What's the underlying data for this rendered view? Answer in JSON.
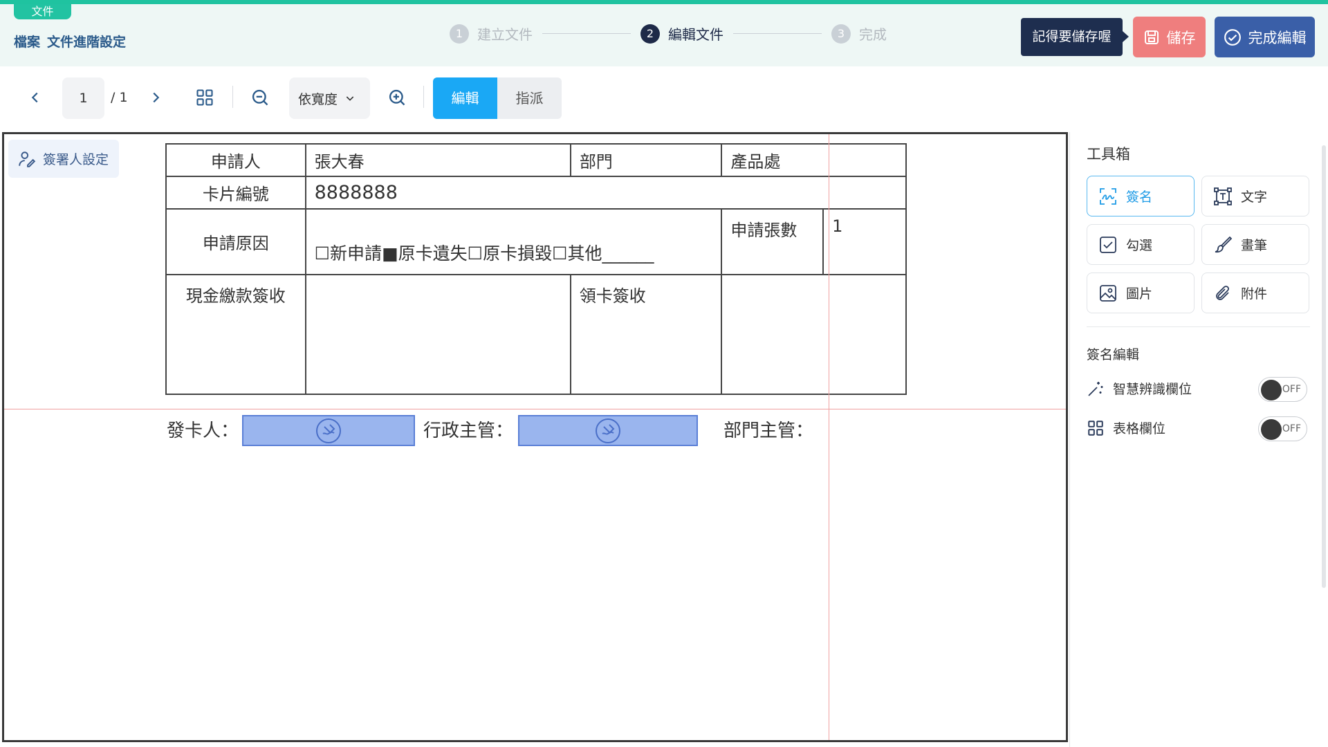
{
  "header": {
    "doc_tag": "文件",
    "breadcrumb_root": "檔案",
    "breadcrumb_page": "文件進階設定",
    "steps": [
      {
        "num": "1",
        "label": "建立文件"
      },
      {
        "num": "2",
        "label": "編輯文件"
      },
      {
        "num": "3",
        "label": "完成"
      }
    ],
    "reminder": "記得要儲存喔",
    "save_label": "儲存",
    "finish_label": "完成編輯"
  },
  "toolbar": {
    "current_page": "1",
    "total_pages": "/ 1",
    "zoom_mode": "依寬度",
    "mode_edit": "編輯",
    "mode_assign": "指派"
  },
  "canvas": {
    "signer_settings": "簽署人設定",
    "form": {
      "applicant_label": "申請人",
      "applicant_value": "張大春",
      "dept_label": "部門",
      "dept_value": "產品處",
      "card_no_label": "卡片編號",
      "card_no_value": "8888888",
      "reason_label": "申請原因",
      "reason_value": "☐新申請■原卡遺失☐原卡損毀☐其他______",
      "count_label": "申請張數",
      "count_value": "1",
      "cash_label": "現金繳款簽收",
      "receive_label": "領卡簽收"
    },
    "signatures": {
      "issuer_label": "發卡人：",
      "admin_label": "行政主管：",
      "dept_manager_label": "部門主管："
    }
  },
  "right_panel": {
    "toolbox_title": "工具箱",
    "tools": [
      {
        "label": "簽名",
        "icon": "signature-icon"
      },
      {
        "label": "文字",
        "icon": "text-icon"
      },
      {
        "label": "勾選",
        "icon": "checkbox-icon"
      },
      {
        "label": "畫筆",
        "icon": "brush-icon"
      },
      {
        "label": "圖片",
        "icon": "image-icon"
      },
      {
        "label": "附件",
        "icon": "paperclip-icon"
      }
    ],
    "sign_edit_title": "簽名編輯",
    "smart_detect_label": "智慧辨識欄位",
    "table_field_label": "表格欄位",
    "toggle_off": "OFF"
  },
  "colors": {
    "accent_teal": "#1fc3a0",
    "primary_blue": "#1aa8f5",
    "save_red": "#ef7e7e",
    "finish_blue": "#3a5fa8",
    "sign_box": "#9ab5ee"
  }
}
